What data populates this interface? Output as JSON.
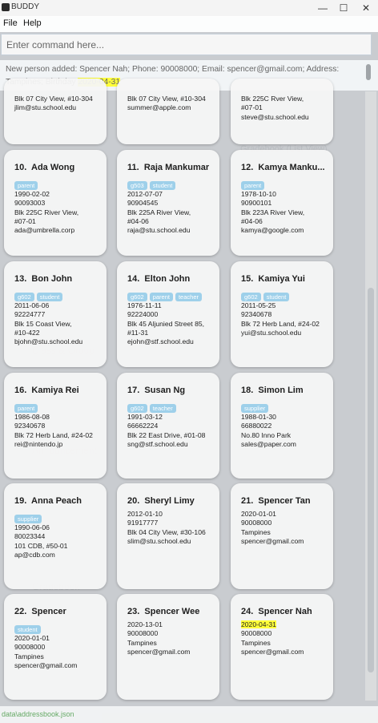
{
  "window": {
    "title": "BUDDY"
  },
  "menu": {
    "file": "File",
    "help": "Help"
  },
  "command": {
    "placeholder": "Enter command here..."
  },
  "result": {
    "prefix": "New person added: Spencer Nah; Phone: 90008000; Email: spencer@gmail.com; Address: Tampines; Birthday ",
    "highlight": "2020-04-31"
  },
  "persons": [
    {
      "index": "10.",
      "name": "Ada Wong",
      "tags": [
        "parent"
      ],
      "birthday": "1990-02-02",
      "phone": "90093003",
      "address": [
        "Blk 225C River View,",
        "#07-01"
      ],
      "email": "ada@umbrella.corp"
    },
    {
      "index": "11.",
      "name": "Raja Mankumar",
      "tags": [
        "g503",
        "student"
      ],
      "birthday": "2012-07-07",
      "phone": "90904545",
      "address": [
        "Blk 225A River View,",
        "#04-06"
      ],
      "email": "raja@stu.school.edu"
    },
    {
      "index": "12.",
      "name": "Kamya Manku...",
      "tags": [
        "parent"
      ],
      "birthday": "1978-10-10",
      "phone": "90900101",
      "address": [
        "Blk 223A River View,",
        "#04-06"
      ],
      "email": "kamya@google.com"
    },
    {
      "index": "13.",
      "name": "Bon John",
      "tags": [
        "g602",
        "student"
      ],
      "birthday": "2011-06-06",
      "phone": "92224777",
      "address": [
        "Blk 15 Coast View,",
        "#10-422"
      ],
      "email": "bjohn@stu.school.edu"
    },
    {
      "index": "14.",
      "name": "Elton John",
      "tags": [
        "g602",
        "parent",
        "teacher"
      ],
      "birthday": "1976-11-11",
      "phone": "92224000",
      "address": [
        "Blk 45 Aljunied Street 85,",
        "#11-31"
      ],
      "email": "ejohn@stf.school.edu"
    },
    {
      "index": "15.",
      "name": "Kamiya Yui",
      "tags": [
        "g602",
        "student"
      ],
      "birthday": "2011-05-25",
      "phone": "92340678",
      "address": [
        "Blk 72 Herb Land, #24-02"
      ],
      "email": "yui@stu.school.edu"
    },
    {
      "index": "16.",
      "name": "Kamiya Rei",
      "tags": [
        "parent"
      ],
      "birthday": "1986-08-08",
      "phone": "92340678",
      "address": [
        "Blk 72 Herb Land, #24-02"
      ],
      "email": "rei@nintendo.jp"
    },
    {
      "index": "17.",
      "name": "Susan Ng",
      "tags": [
        "g602",
        "teacher"
      ],
      "birthday": "1991-03-12",
      "phone": "66662224",
      "address": [
        "Blk 22 East Drive, #01-08"
      ],
      "email": "sng@stf.school.edu"
    },
    {
      "index": "18.",
      "name": "Simon Lim",
      "tags": [
        "supplier"
      ],
      "birthday": "1988-01-30",
      "phone": "66880022",
      "address": [
        "No.80 Inno Park"
      ],
      "email": "sales@paper.com"
    },
    {
      "index": "19.",
      "name": "Anna Peach",
      "tags": [
        "supplier"
      ],
      "birthday": "1990-06-06",
      "phone": "80023344",
      "address": [
        "101 CDB, #50-01"
      ],
      "email": "ap@cdb.com"
    },
    {
      "index": "20.",
      "name": "Sheryl Limy",
      "tags": [],
      "birthday": "2012-01-10",
      "phone": "91917777",
      "address": [
        "Blk 04 City View, #30-106"
      ],
      "email": "slim@stu.school.edu"
    },
    {
      "index": "21.",
      "name": "Spencer Tan",
      "tags": [],
      "birthday": "2020-01-01",
      "phone": "90008000",
      "address": [
        "Tampines"
      ],
      "email": "spencer@gmail.com"
    },
    {
      "index": "22.",
      "name": "Spencer",
      "tags": [
        "student"
      ],
      "birthday": "2020-01-01",
      "phone": "90008000",
      "address": [
        "Tampines"
      ],
      "email": "spencer@gmail.com"
    },
    {
      "index": "23.",
      "name": "Spencer Wee",
      "tags": [],
      "birthday": "2020-13-01",
      "phone": "90008000",
      "address": [
        "Tampines"
      ],
      "email": "spencer@gmail.com"
    },
    {
      "index": "24.",
      "name": "Spencer Nah",
      "tags": [],
      "birthday": "2020-04-31",
      "birthday_highlight": true,
      "phone": "90008000",
      "address": [
        "Tampines"
      ],
      "email": "spencer@gmail.com"
    }
  ],
  "partial_cards": [
    {
      "lines": [
        "Blk 07 City View, #10-304",
        "jlim@stu.school.edu"
      ]
    },
    {
      "lines": [
        "Blk 07 City View, #10-304",
        "summer@apple.com"
      ]
    },
    {
      "lines": [
        "Blk 225C Rver View,",
        "#07-01",
        "steve@stu.school.edu"
      ]
    }
  ],
  "status": {
    "path": "data\\addressbook.json"
  }
}
